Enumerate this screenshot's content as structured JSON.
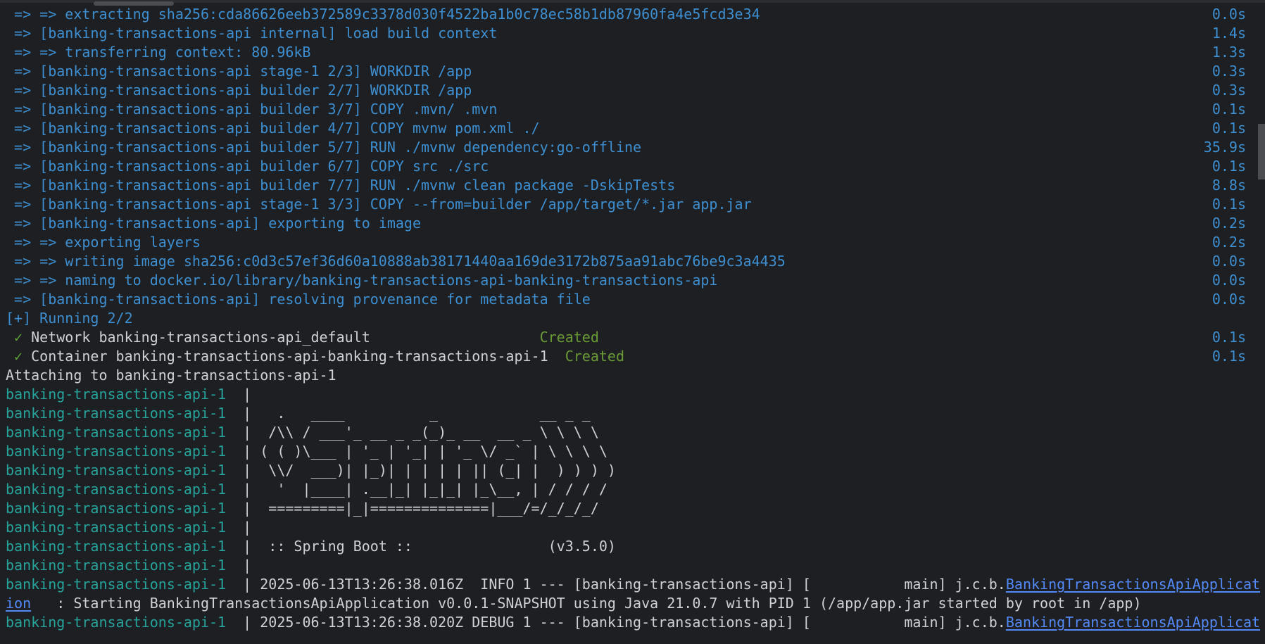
{
  "colors": {
    "build": "#3d8fd1",
    "log": "#cfd1d4",
    "container_prefix": "#26a39b",
    "check": "#5fa33a",
    "created": "#6a9a36",
    "link": "#548af7",
    "background": "#1e1f22"
  },
  "lines": [
    {
      "segs": [
        {
          "c": "b",
          "t": " => => extracting sha256:cda86626eeb372589c3378d030f4522ba1b0c78ec58b1db87960fa4e5fcd3e34"
        }
      ],
      "time": "0.0s"
    },
    {
      "segs": [
        {
          "c": "b",
          "t": " => [banking-transactions-api internal] load build context"
        }
      ],
      "time": "1.4s"
    },
    {
      "segs": [
        {
          "c": "b",
          "t": " => => transferring context: 80.96kB"
        }
      ],
      "time": "1.3s"
    },
    {
      "segs": [
        {
          "c": "b",
          "t": " => [banking-transactions-api stage-1 2/3] WORKDIR /app"
        }
      ],
      "time": "0.3s"
    },
    {
      "segs": [
        {
          "c": "b",
          "t": " => [banking-transactions-api builder 2/7] WORKDIR /app"
        }
      ],
      "time": "0.3s"
    },
    {
      "segs": [
        {
          "c": "b",
          "t": " => [banking-transactions-api builder 3/7] COPY .mvn/ .mvn"
        }
      ],
      "time": "0.1s"
    },
    {
      "segs": [
        {
          "c": "b",
          "t": " => [banking-transactions-api builder 4/7] COPY mvnw pom.xml ./"
        }
      ],
      "time": "0.1s"
    },
    {
      "segs": [
        {
          "c": "b",
          "t": " => [banking-transactions-api builder 5/7] RUN ./mvnw dependency:go-offline"
        }
      ],
      "time": "35.9s"
    },
    {
      "segs": [
        {
          "c": "b",
          "t": " => [banking-transactions-api builder 6/7] COPY src ./src"
        }
      ],
      "time": "0.1s"
    },
    {
      "segs": [
        {
          "c": "b",
          "t": " => [banking-transactions-api builder 7/7] RUN ./mvnw clean package -DskipTests"
        }
      ],
      "time": "8.8s"
    },
    {
      "segs": [
        {
          "c": "b",
          "t": " => [banking-transactions-api stage-1 3/3] COPY --from=builder /app/target/*.jar app.jar"
        }
      ],
      "time": "0.1s"
    },
    {
      "segs": [
        {
          "c": "b",
          "t": " => [banking-transactions-api] exporting to image"
        }
      ],
      "time": "0.2s"
    },
    {
      "segs": [
        {
          "c": "b",
          "t": " => => exporting layers"
        }
      ],
      "time": "0.2s"
    },
    {
      "segs": [
        {
          "c": "b",
          "t": " => => writing image sha256:c0d3c57ef36d60a10888ab38171440aa169de3172b875aa91abc76be9c3a4435"
        }
      ],
      "time": "0.0s"
    },
    {
      "segs": [
        {
          "c": "b",
          "t": " => => naming to docker.io/library/banking-transactions-api-banking-transactions-api"
        }
      ],
      "time": "0.0s"
    },
    {
      "segs": [
        {
          "c": "b",
          "t": " => [banking-transactions-api] resolving provenance for metadata file"
        }
      ],
      "time": "0.0s"
    },
    {
      "segs": [
        {
          "c": "b",
          "t": "[+] Running 2/2"
        }
      ]
    },
    {
      "segs": [
        {
          "c": "g",
          "t": " ✓ "
        },
        {
          "c": "w",
          "t": "Network banking-transactions-api_default                    "
        },
        {
          "c": "cr",
          "t": "Created"
        }
      ],
      "time": "0.1s"
    },
    {
      "segs": [
        {
          "c": "g",
          "t": " ✓ "
        },
        {
          "c": "w",
          "t": "Container banking-transactions-api-banking-transactions-api-1  "
        },
        {
          "c": "cr",
          "t": "Created"
        }
      ],
      "time": "0.1s"
    },
    {
      "segs": [
        {
          "c": "w",
          "t": "Attaching to banking-transactions-api-1"
        }
      ]
    },
    {
      "segs": [
        {
          "c": "t",
          "t": "banking-transactions-api-1  "
        },
        {
          "c": "w",
          "t": "|"
        }
      ]
    },
    {
      "segs": [
        {
          "c": "t",
          "t": "banking-transactions-api-1  "
        },
        {
          "c": "w",
          "t": "|   .   ____          _            __ _ _"
        }
      ]
    },
    {
      "segs": [
        {
          "c": "t",
          "t": "banking-transactions-api-1  "
        },
        {
          "c": "w",
          "t": "|  /\\\\ / ___'_ __ _ _(_)_ __  __ _ \\ \\ \\ \\"
        }
      ]
    },
    {
      "segs": [
        {
          "c": "t",
          "t": "banking-transactions-api-1  "
        },
        {
          "c": "w",
          "t": "| ( ( )\\___ | '_ | '_| | '_ \\/ _` | \\ \\ \\ \\"
        }
      ]
    },
    {
      "segs": [
        {
          "c": "t",
          "t": "banking-transactions-api-1  "
        },
        {
          "c": "w",
          "t": "|  \\\\/  ___)| |_)| | | | | || (_| |  ) ) ) )"
        }
      ]
    },
    {
      "segs": [
        {
          "c": "t",
          "t": "banking-transactions-api-1  "
        },
        {
          "c": "w",
          "t": "|   '  |____| .__|_| |_|_| |_\\__, | / / / /"
        }
      ]
    },
    {
      "segs": [
        {
          "c": "t",
          "t": "banking-transactions-api-1  "
        },
        {
          "c": "w",
          "t": "|  =========|_|==============|___/=/_/_/_/"
        }
      ]
    },
    {
      "segs": [
        {
          "c": "t",
          "t": "banking-transactions-api-1  "
        },
        {
          "c": "w",
          "t": "|"
        }
      ]
    },
    {
      "segs": [
        {
          "c": "t",
          "t": "banking-transactions-api-1  "
        },
        {
          "c": "w",
          "t": "|  :: Spring Boot ::                (v3.5.0)"
        }
      ]
    },
    {
      "segs": [
        {
          "c": "t",
          "t": "banking-transactions-api-1  "
        },
        {
          "c": "w",
          "t": "|"
        }
      ]
    },
    {
      "segs": [
        {
          "c": "t",
          "t": "banking-transactions-api-1  "
        },
        {
          "c": "w",
          "t": "| 2025-06-13T13:26:38.016Z  INFO 1 --- [banking-transactions-api] [           main] j.c.b."
        },
        {
          "c": "l",
          "t": "BankingTransactionsApiApplicat"
        }
      ]
    },
    {
      "segs": [
        {
          "c": "l",
          "t": "ion"
        },
        {
          "c": "w",
          "t": "   : Starting BankingTransactionsApiApplication v0.0.1-SNAPSHOT using Java 21.0.7 with PID 1 (/app/app.jar started by root in /app)"
        }
      ]
    },
    {
      "segs": [
        {
          "c": "t",
          "t": "banking-transactions-api-1  "
        },
        {
          "c": "w",
          "t": "| 2025-06-13T13:26:38.020Z DEBUG 1 --- [banking-transactions-api] [           main] j.c.b."
        },
        {
          "c": "l",
          "t": "BankingTransactionsApiApplicat"
        }
      ]
    }
  ]
}
